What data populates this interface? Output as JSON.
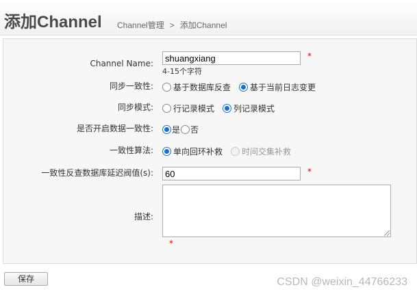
{
  "header": {
    "title": "添加Channel",
    "breadcrumb": {
      "parent": "Channel管理",
      "separator": ">",
      "current": "添加Channel"
    }
  },
  "form": {
    "channel_name": {
      "label": "Channel Name:",
      "value": "shuangxiang",
      "hint": "4-15个字符",
      "required_mark": "*"
    },
    "consistency": {
      "label": "同步一致性:",
      "options": [
        "基于数据库反查",
        "基于当前日志变更"
      ],
      "selected": "基于当前日志变更"
    },
    "sync_mode": {
      "label": "同步模式:",
      "options": [
        "行记录模式",
        "列记录模式"
      ],
      "selected": "列记录模式"
    },
    "enable_consistency": {
      "label": "是否开启数据一致性:",
      "options": [
        "是",
        "否"
      ],
      "selected": "是"
    },
    "algorithm": {
      "label": "一致性算法:",
      "options": [
        "单向回环补救",
        "时间交集补救"
      ],
      "selected": "单向回环补救",
      "disabled": "时间交集补救"
    },
    "delay_threshold": {
      "label": "一致性反查数据库延迟阀值(s):",
      "value": "60",
      "required_mark": "*"
    },
    "description": {
      "label": "描述:",
      "value": "",
      "required_mark": "*"
    }
  },
  "actions": {
    "save_label": "保存"
  },
  "watermark": "CSDN @weixin_44766233",
  "colors": {
    "accent": "#1f6fc5",
    "required": "#dd0000",
    "panel_bg": "#f7f7f7"
  }
}
